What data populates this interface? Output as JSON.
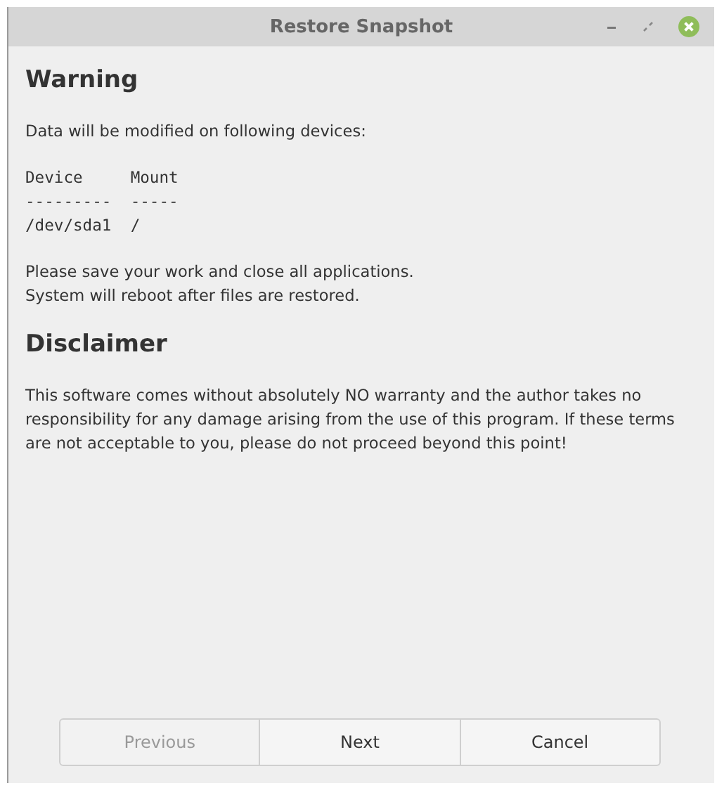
{
  "window": {
    "title": "Restore Snapshot",
    "controls": [
      {
        "kind": "minimize"
      },
      {
        "kind": "maximize"
      },
      {
        "kind": "close"
      }
    ]
  },
  "sections": [
    {
      "heading": "Warning",
      "blocks": [
        {
          "kind": "text",
          "lines": [
            "Data will be modified on following devices:"
          ]
        },
        {
          "kind": "mono",
          "lines": [
            "Device     Mount",
            "---------  -----",
            "/dev/sda1  /"
          ]
        },
        {
          "kind": "text",
          "lines": [
            "Please save your work and close all applications.",
            "System will reboot after files are restored."
          ]
        }
      ]
    },
    {
      "heading": "Disclaimer",
      "blocks": [
        {
          "kind": "text",
          "lines": [
            "This software comes without absolutely NO warranty and the author takes no responsibility for any damage arising from the use of this program. If these terms are not acceptable to you, please do not proceed beyond this point!"
          ]
        }
      ]
    }
  ],
  "buttons": [
    {
      "label": "Previous",
      "disabled": true
    },
    {
      "label": "Next",
      "disabled": false
    },
    {
      "label": "Cancel",
      "disabled": false
    }
  ]
}
